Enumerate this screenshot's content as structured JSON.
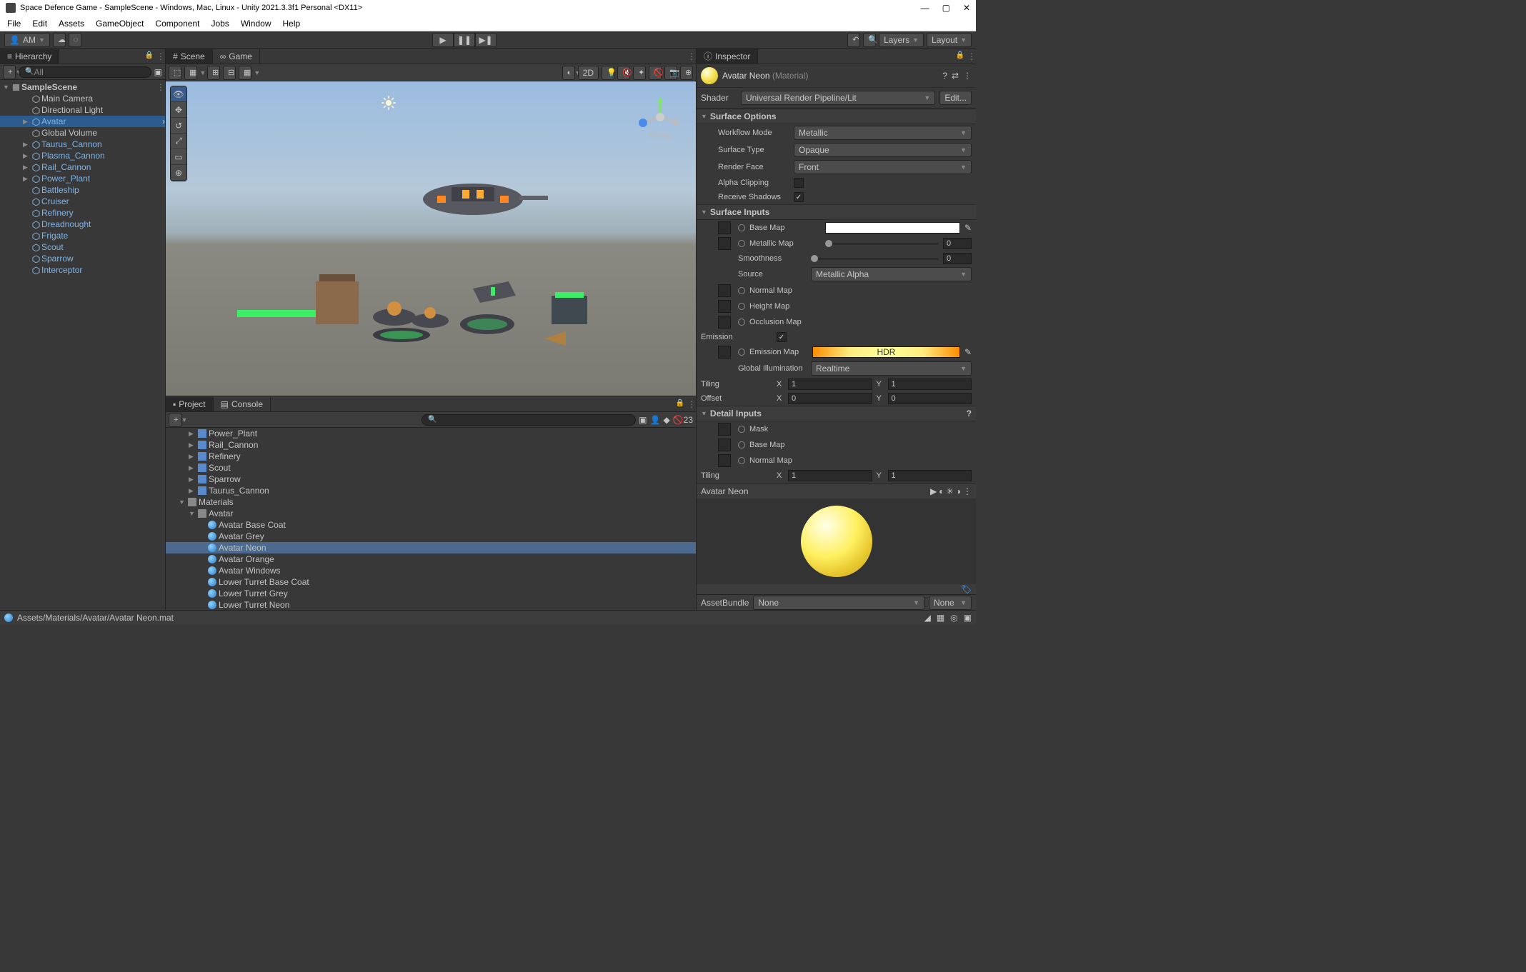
{
  "titlebar": {
    "text": "Space Defence Game - SampleScene - Windows, Mac, Linux - Unity 2021.3.3f1 Personal <DX11>"
  },
  "menubar": [
    "File",
    "Edit",
    "Assets",
    "GameObject",
    "Component",
    "Jobs",
    "Window",
    "Help"
  ],
  "topbar": {
    "account": "AM",
    "layers": "Layers",
    "layout": "Layout"
  },
  "hierarchy": {
    "title": "Hierarchy",
    "searchPlaceholder": "All",
    "scene": "SampleScene",
    "items": [
      {
        "name": "Main Camera",
        "active": false,
        "fold": false,
        "indent": 2
      },
      {
        "name": "Directional Light",
        "active": false,
        "fold": false,
        "indent": 2
      },
      {
        "name": "Avatar",
        "active": true,
        "fold": true,
        "indent": 2,
        "selected": true
      },
      {
        "name": "Global Volume",
        "active": false,
        "fold": false,
        "indent": 2
      },
      {
        "name": "Taurus_Cannon",
        "active": true,
        "fold": true,
        "indent": 2
      },
      {
        "name": "Plasma_Cannon",
        "active": true,
        "fold": true,
        "indent": 2
      },
      {
        "name": "Rail_Cannon",
        "active": true,
        "fold": true,
        "indent": 2
      },
      {
        "name": "Power_Plant",
        "active": true,
        "fold": true,
        "indent": 2
      },
      {
        "name": "Battleship",
        "active": true,
        "fold": false,
        "indent": 2
      },
      {
        "name": "Cruiser",
        "active": true,
        "fold": false,
        "indent": 2
      },
      {
        "name": "Refinery",
        "active": true,
        "fold": false,
        "indent": 2
      },
      {
        "name": "Dreadnought",
        "active": true,
        "fold": false,
        "indent": 2
      },
      {
        "name": "Frigate",
        "active": true,
        "fold": false,
        "indent": 2
      },
      {
        "name": "Scout",
        "active": true,
        "fold": false,
        "indent": 2
      },
      {
        "name": "Sparrow",
        "active": true,
        "fold": false,
        "indent": 2
      },
      {
        "name": "Interceptor",
        "active": true,
        "fold": false,
        "indent": 2
      }
    ]
  },
  "scene": {
    "tabScene": "Scene",
    "tabGame": "Game",
    "btn2d": "2D",
    "perspLabel": "Persp"
  },
  "project": {
    "tabProject": "Project",
    "tabConsole": "Console",
    "count": "23",
    "items": [
      {
        "name": "Power_Plant",
        "type": "prefab",
        "indent": 2,
        "fold": true
      },
      {
        "name": "Rail_Cannon",
        "type": "prefab",
        "indent": 2,
        "fold": true
      },
      {
        "name": "Refinery",
        "type": "prefab",
        "indent": 2,
        "fold": true
      },
      {
        "name": "Scout",
        "type": "prefab",
        "indent": 2,
        "fold": true
      },
      {
        "name": "Sparrow",
        "type": "prefab",
        "indent": 2,
        "fold": true
      },
      {
        "name": "Taurus_Cannon",
        "type": "prefab",
        "indent": 2,
        "fold": true
      },
      {
        "name": "Materials",
        "type": "folder",
        "indent": 1,
        "fold": true,
        "open": true
      },
      {
        "name": "Avatar",
        "type": "folder",
        "indent": 2,
        "fold": true,
        "open": true
      },
      {
        "name": "Avatar Base Coat",
        "type": "mat",
        "indent": 3
      },
      {
        "name": "Avatar Grey",
        "type": "mat",
        "indent": 3
      },
      {
        "name": "Avatar Neon",
        "type": "mat",
        "indent": 3,
        "selected": true
      },
      {
        "name": "Avatar Orange",
        "type": "mat",
        "indent": 3
      },
      {
        "name": "Avatar Windows",
        "type": "mat",
        "indent": 3
      },
      {
        "name": "Lower Turret Base Coat",
        "type": "mat",
        "indent": 3
      },
      {
        "name": "Lower Turret Grey",
        "type": "mat",
        "indent": 3
      },
      {
        "name": "Lower Turret Neon",
        "type": "mat",
        "indent": 3
      }
    ]
  },
  "statusbar": {
    "path": "Assets/Materials/Avatar/Avatar Neon.mat"
  },
  "inspector": {
    "title": "Inspector",
    "matName": "Avatar Neon",
    "matSuffix": "(Material)",
    "shaderLabel": "Shader",
    "shaderValue": "Universal Render Pipeline/Lit",
    "editBtn": "Edit...",
    "sectSurfOpt": "Surface Options",
    "workflowMode": {
      "label": "Workflow Mode",
      "value": "Metallic"
    },
    "surfaceType": {
      "label": "Surface Type",
      "value": "Opaque"
    },
    "renderFace": {
      "label": "Render Face",
      "value": "Front"
    },
    "alphaClipping": {
      "label": "Alpha Clipping"
    },
    "receiveShadows": {
      "label": "Receive Shadows"
    },
    "sectSurfIn": "Surface Inputs",
    "baseMap": {
      "label": "Base Map"
    },
    "metallicMap": {
      "label": "Metallic Map",
      "value": "0"
    },
    "smoothness": {
      "label": "Smoothness",
      "value": "0"
    },
    "source": {
      "label": "Source",
      "value": "Metallic Alpha"
    },
    "normalMap": {
      "label": "Normal Map"
    },
    "heightMap": {
      "label": "Height Map"
    },
    "occlusionMap": {
      "label": "Occlusion Map"
    },
    "emission": {
      "label": "Emission"
    },
    "emissionMap": {
      "label": "Emission Map",
      "hdr": "HDR"
    },
    "globalIllum": {
      "label": "Global Illumination",
      "value": "Realtime"
    },
    "tiling": {
      "label": "Tiling",
      "x": "1",
      "y": "1"
    },
    "offset": {
      "label": "Offset",
      "x": "0",
      "y": "0"
    },
    "sectDetail": "Detail Inputs",
    "mask": {
      "label": "Mask"
    },
    "detBaseMap": {
      "label": "Base Map"
    },
    "detNormalMap": {
      "label": "Normal Map"
    },
    "detTiling": {
      "label": "Tiling",
      "x": "1",
      "y": "1"
    },
    "previewName": "Avatar Neon",
    "assetBundle": {
      "label": "AssetBundle",
      "v1": "None",
      "v2": "None"
    }
  }
}
